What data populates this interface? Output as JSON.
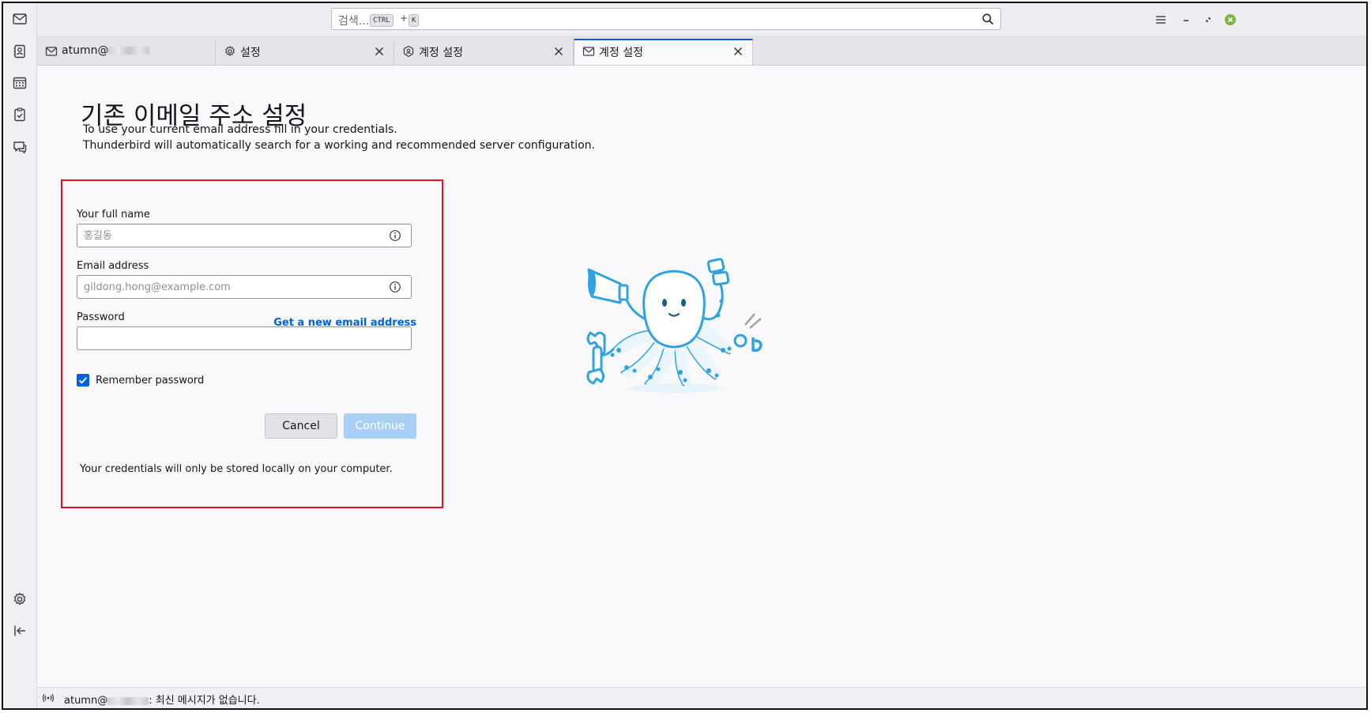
{
  "spaces": [
    {
      "name": "mail-space-button",
      "icon": "mail-icon"
    },
    {
      "name": "address-book-space-button",
      "icon": "address-book-icon"
    },
    {
      "name": "calendar-space-button",
      "icon": "calendar-icon"
    },
    {
      "name": "tasks-space-button",
      "icon": "tasks-icon"
    },
    {
      "name": "chat-space-button",
      "icon": "chat-icon"
    }
  ],
  "search": {
    "placeholder": "검색...",
    "shortcut_ctrl": "CTRL",
    "shortcut_plus": "+",
    "shortcut_key": "K"
  },
  "tabs": [
    {
      "label": "atumn@",
      "icon": "mail-icon",
      "active": false
    },
    {
      "label": "설정",
      "icon": "gear-icon",
      "active": false
    },
    {
      "label": "계정 설정",
      "icon": "account-settings-icon",
      "active": false
    },
    {
      "label": "계정 설정",
      "icon": "mail-icon",
      "active": true
    }
  ],
  "page": {
    "title": "기존 이메일 주소 설정",
    "desc_line1": "To use your current email address fill in your credentials.",
    "desc_line2": "Thunderbird will automatically search for a working and recommended server configuration."
  },
  "form": {
    "full_name_label": "Your full name",
    "full_name_placeholder": "홍길동",
    "email_label": "Email address",
    "email_placeholder": "gildong.hong@example.com",
    "new_email_link": "Get a new email address",
    "password_label": "Password",
    "password_value": "",
    "remember_label": "Remember password",
    "remember_checked": true,
    "cancel_label": "Cancel",
    "continue_label": "Continue",
    "note": "Your credentials will only be stored locally on your computer."
  },
  "status": {
    "prefix": "atumn@",
    "message": ": 최신 메시지가 없습니다."
  },
  "colors": {
    "accent": "#0061e0",
    "highlight_border": "#e0121f",
    "continue_disabled": "#a8cff6",
    "mascot": "#2ea3df"
  }
}
